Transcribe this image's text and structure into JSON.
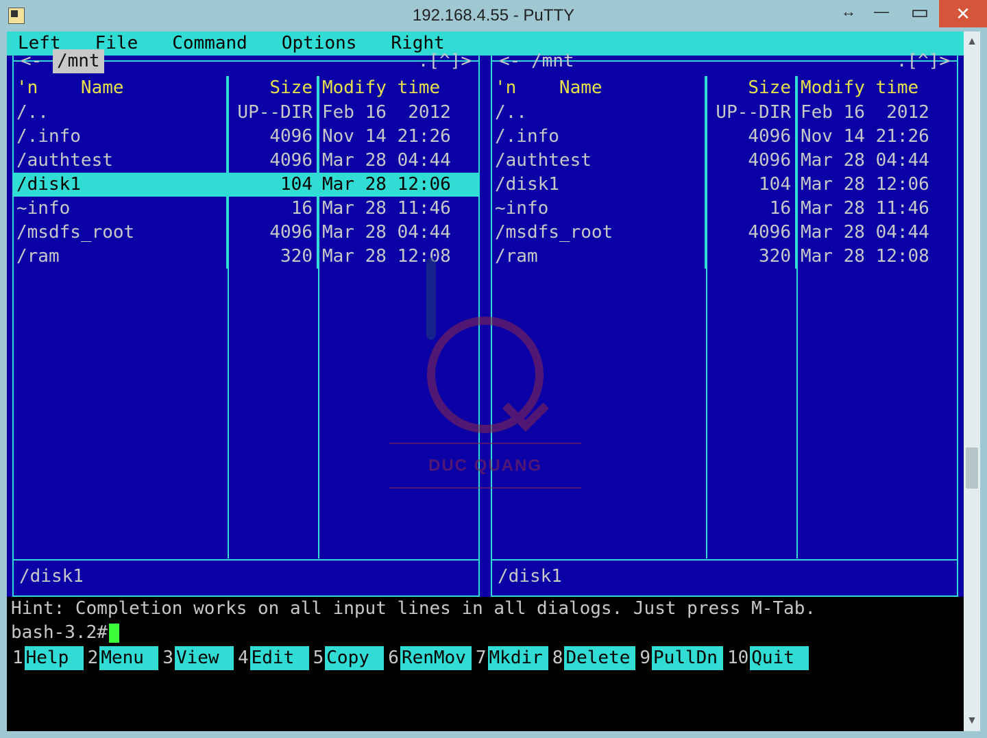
{
  "window": {
    "title": "192.168.4.55 - PuTTY"
  },
  "mc": {
    "menu": {
      "left": "Left",
      "file": "File",
      "command": "Command",
      "options": "Options",
      "right": "Right"
    },
    "panels": {
      "left": {
        "path": "/mnt",
        "top_right": ".[^]>",
        "top_left_prefix": "<-",
        "headers": {
          "name": "'n    Name",
          "size": "Size",
          "mtime": "Modify time"
        },
        "rows": [
          {
            "name": "/..",
            "size": "UP--DIR",
            "mtime": "Feb 16  2012",
            "selected": false
          },
          {
            "name": "/.info",
            "size": "4096",
            "mtime": "Nov 14 21:26",
            "selected": false
          },
          {
            "name": "/authtest",
            "size": "4096",
            "mtime": "Mar 28 04:44",
            "selected": false
          },
          {
            "name": "/disk1",
            "size": "104",
            "mtime": "Mar 28 12:06",
            "selected": true
          },
          {
            "name": "~info",
            "size": "16",
            "mtime": "Mar 28 11:46",
            "selected": false
          },
          {
            "name": "/msdfs_root",
            "size": "4096",
            "mtime": "Mar 28 04:44",
            "selected": false
          },
          {
            "name": "/ram",
            "size": "320",
            "mtime": "Mar 28 12:08",
            "selected": false
          }
        ],
        "status": "/disk1"
      },
      "right": {
        "path": "/mnt",
        "top_right": ".[^]>",
        "top_left_prefix": "<-",
        "headers": {
          "name": "'n    Name",
          "size": "Size",
          "mtime": "Modify time"
        },
        "rows": [
          {
            "name": "/..",
            "size": "UP--DIR",
            "mtime": "Feb 16  2012",
            "selected": false
          },
          {
            "name": "/.info",
            "size": "4096",
            "mtime": "Nov 14 21:26",
            "selected": false
          },
          {
            "name": "/authtest",
            "size": "4096",
            "mtime": "Mar 28 04:44",
            "selected": false
          },
          {
            "name": "/disk1",
            "size": "104",
            "mtime": "Mar 28 12:06",
            "selected": false
          },
          {
            "name": "~info",
            "size": "16",
            "mtime": "Mar 28 11:46",
            "selected": false
          },
          {
            "name": "/msdfs_root",
            "size": "4096",
            "mtime": "Mar 28 04:44",
            "selected": false
          },
          {
            "name": "/ram",
            "size": "320",
            "mtime": "Mar 28 12:08",
            "selected": false
          }
        ],
        "status": "/disk1"
      }
    },
    "hint": "Hint: Completion works on all input lines in all dialogs. Just press M-Tab.",
    "prompt": "bash-3.2#",
    "fkeys": [
      {
        "num": "1",
        "label": "Help"
      },
      {
        "num": "2",
        "label": "Menu"
      },
      {
        "num": "3",
        "label": "View"
      },
      {
        "num": "4",
        "label": "Edit"
      },
      {
        "num": "5",
        "label": "Copy"
      },
      {
        "num": "6",
        "label": "RenMov"
      },
      {
        "num": "7",
        "label": "Mkdir"
      },
      {
        "num": "8",
        "label": "Delete"
      },
      {
        "num": "9",
        "label": "PullDn"
      },
      {
        "num": "10",
        "label": "Quit"
      }
    ]
  },
  "watermark": {
    "text": "DUC QUANG"
  }
}
